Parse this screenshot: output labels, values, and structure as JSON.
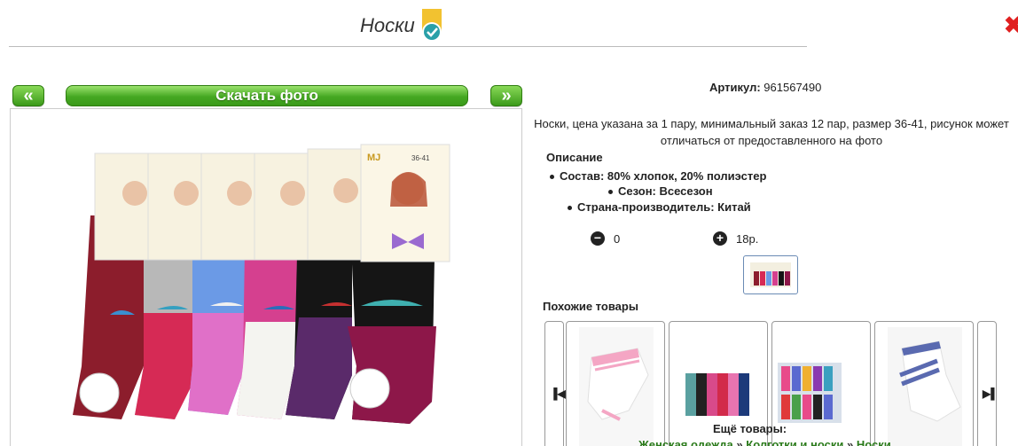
{
  "header": {
    "title": "Носки"
  },
  "gallery": {
    "prev_label": "«",
    "next_label": "»",
    "download_label": "Скачать фото",
    "photo_size_tag": "36-41",
    "brand": "MJ"
  },
  "product": {
    "sku_label": "Артикул:",
    "sku_value": "961567490",
    "description": "Носки, цена указана за 1 пару, минимальный заказ 12 пар, размер 36-41, рисунок может отличаться от предоставленного на фото",
    "specs_title": "Описание",
    "specs": [
      "Состав: 80% хлопок, 20% полиэстер",
      "Сезон: Всесезон",
      "Страна-производитель: Китай"
    ],
    "quantity": "0",
    "price": "18р."
  },
  "similar": {
    "title": "Похожие товары",
    "more_label": "Ещё товары:",
    "breadcrumbs": [
      "Женская одежда",
      "Колготки и носки",
      "Носки"
    ],
    "separator": "»"
  },
  "colors": {
    "accent_green": "#45a822",
    "close_red": "#e02020"
  }
}
